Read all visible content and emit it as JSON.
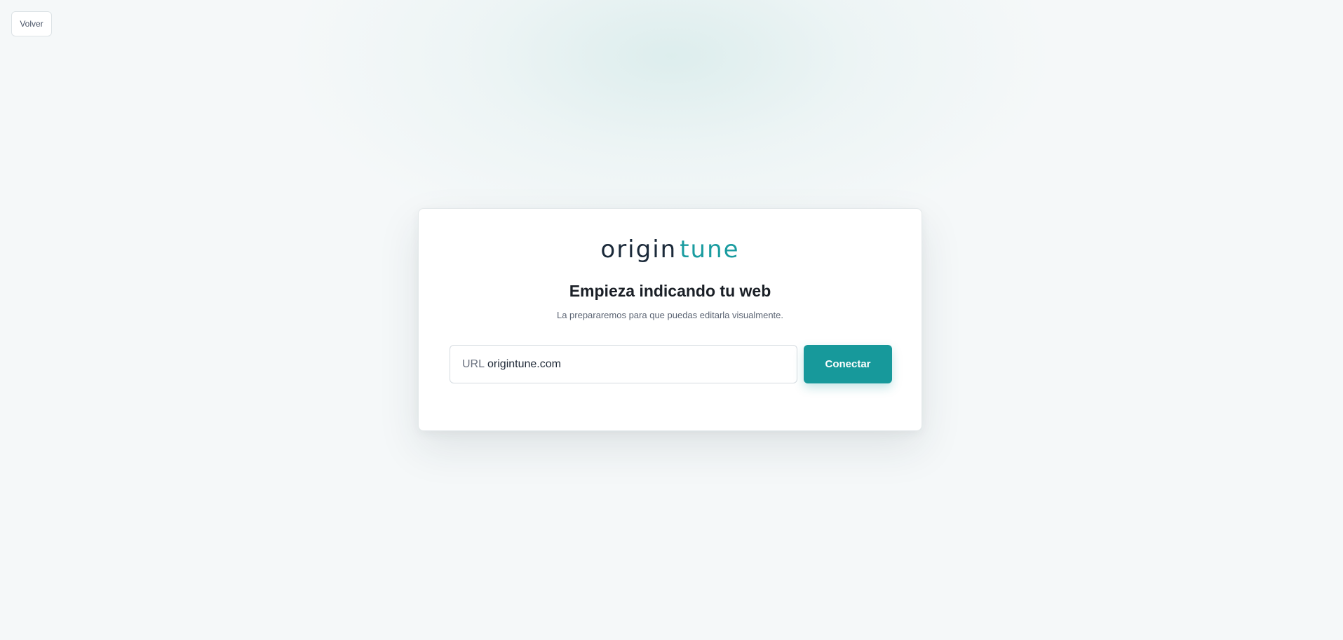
{
  "header": {
    "back_label": "Volver"
  },
  "brand": {
    "logo_part1": "origin",
    "logo_part2": "tune",
    "dark_color": "#1b2a3a",
    "accent_color": "#1a9ca0"
  },
  "main": {
    "title": "Empieza indicando tu web",
    "subtitle": "La prepararemos para que puedas editarla visualmente.",
    "url_prefix": "URL",
    "url_value": "origintune.com",
    "connect_label": "Conectar"
  }
}
